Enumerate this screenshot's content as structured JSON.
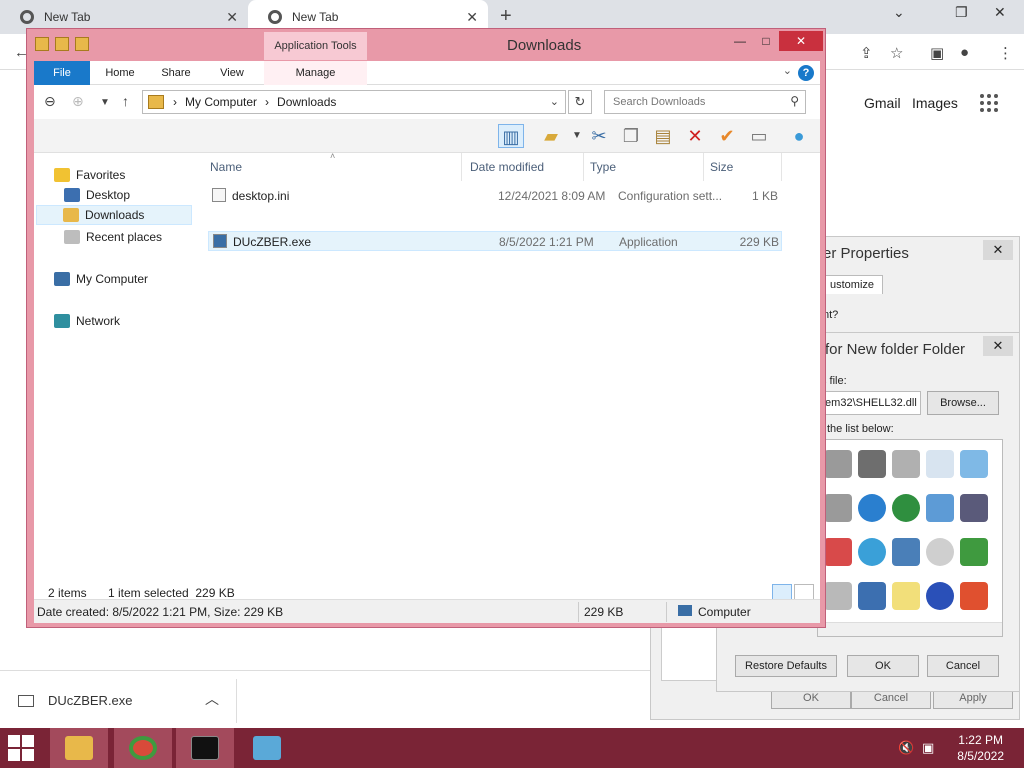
{
  "chrome": {
    "tabs": [
      {
        "label": "New Tab"
      },
      {
        "label": "New Tab"
      }
    ],
    "new_tab_glyph": "+",
    "links": {
      "gmail": "Gmail",
      "images": "Images"
    },
    "download_file": "DUcZBER.exe"
  },
  "explorer": {
    "title": "Downloads",
    "application_tools": "Application Tools",
    "ribbon": {
      "file": "File",
      "home": "Home",
      "share": "Share",
      "view": "View",
      "manage": "Manage"
    },
    "address": {
      "segments": [
        "My Computer",
        "Downloads"
      ],
      "search_placeholder": "Search Downloads"
    },
    "nav": {
      "favorites": "Favorites",
      "desktop": "Desktop",
      "downloads": "Downloads",
      "recent": "Recent places",
      "computer": "My Computer",
      "network": "Network"
    },
    "columns": {
      "name": "Name",
      "date": "Date modified",
      "type": "Type",
      "size": "Size"
    },
    "files": [
      {
        "name": "desktop.ini",
        "date": "12/24/2021 8:09 AM",
        "type": "Configuration sett...",
        "size": "1 KB"
      },
      {
        "name": "DUcZBER.exe",
        "date": "8/5/2022 1:21 PM",
        "type": "Application",
        "size": "229 KB"
      }
    ],
    "status": {
      "items": "2 items",
      "selected": "1 item selected  229 KB"
    },
    "details": {
      "created": "Date created: 8/5/2022 1:21 PM, Size: 229 KB",
      "size": "229 KB",
      "location": "Computer"
    }
  },
  "back_dialog": {
    "title": "er Properties",
    "tab": "ustomize",
    "question": "nt?",
    "buttons": {
      "ok": "OK",
      "cancel": "Cancel",
      "apply": "Apply"
    }
  },
  "icon_dialog": {
    "title": "for New folder Folder",
    "file_label": "s file:",
    "path": "tem32\\SHELL32.dll",
    "browse": "Browse...",
    "list_label": "the list below:",
    "buttons": {
      "restore": "Restore Defaults",
      "ok": "OK",
      "cancel": "Cancel"
    }
  },
  "taskbar": {
    "time": "1:22 PM",
    "date": "8/5/2022"
  },
  "colors": {
    "explorer_frame": "#e899a8",
    "taskbar": "#7a2436",
    "accent": "#1979ca",
    "close_red": "#c9303e"
  }
}
